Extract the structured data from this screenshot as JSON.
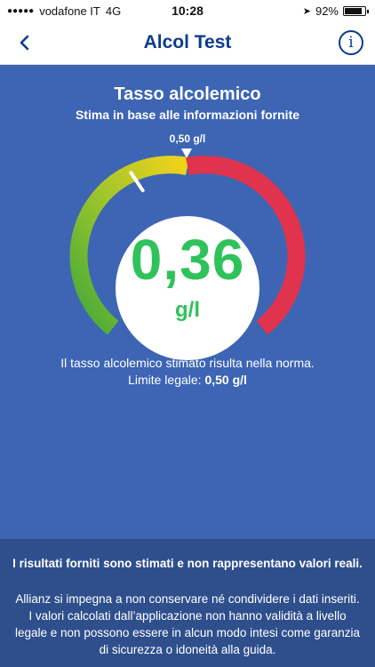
{
  "status_bar": {
    "signal_dots": "●●●●●",
    "carrier": "vodafone IT",
    "network": "4G",
    "time": "10:28",
    "battery": "92%"
  },
  "nav": {
    "back_icon": "chevron-left-icon",
    "title": "Alcol Test",
    "info_icon": "info-icon"
  },
  "gauge": {
    "title": "Tasso alcolemico",
    "subtitle": "Stima in base alle informazioni fornite",
    "limit_marker_label": "0,50 g/l",
    "value": "0,36",
    "unit": "g/l",
    "numeric_value": 0.36,
    "legal_limit": 0.5,
    "colors": {
      "green": "#43a838",
      "yellow": "#f4d31a",
      "red": "#e0334d",
      "value_text": "#2fc25b"
    }
  },
  "result": {
    "message": "Il tasso alcolemico stimato risulta nella norma.",
    "limit_prefix": "Limite legale:",
    "limit_value": "0,50 g/l"
  },
  "disclaimer": {
    "bold_text": "I risultati forniti sono stimati e non rappresentano valori reali.",
    "text": "Allianz si impegna a non conservare né condividere i dati inseriti. I valori calcolati dall’applicazione non hanno validità a livello legale e non possono essere in alcun modo intesi come garanzia di sicurezza o idoneità alla guida."
  },
  "colors": {
    "background": "#3d65b3",
    "disclaimer_bg": "#2f4f8c",
    "brand": "#0a3c8c"
  }
}
